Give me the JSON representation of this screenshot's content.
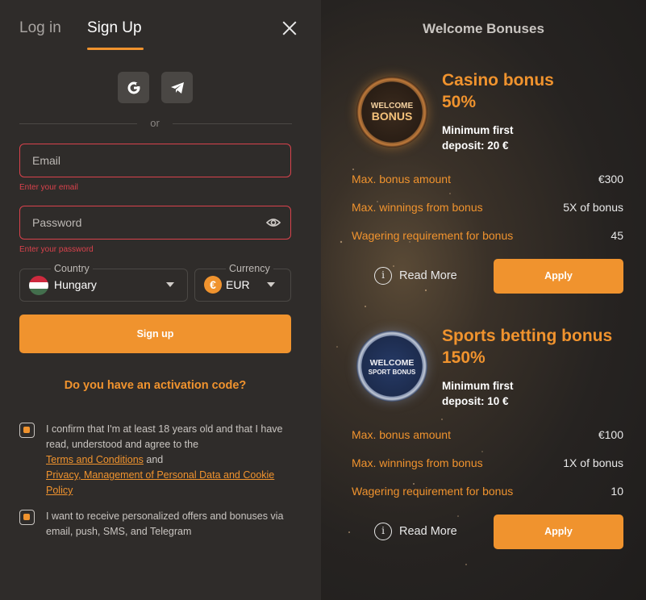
{
  "tabs": {
    "login": "Log in",
    "signup": "Sign Up"
  },
  "divider": "or",
  "email": {
    "placeholder": "Email",
    "error": "Enter your email"
  },
  "password": {
    "placeholder": "Password",
    "error": "Enter your password"
  },
  "country": {
    "legend": "Country",
    "value": "Hungary"
  },
  "currency": {
    "legend": "Currency",
    "value": "EUR",
    "symbol": "€"
  },
  "signup_button": "Sign up",
  "activation_link": "Do you have an activation code?",
  "consent": {
    "age_text": "I confirm that I'm at least 18 years old and that I have read, understood and agree to the",
    "terms_link": "Terms and Conditions",
    "and": "and",
    "privacy_link": "Privacy, Management of Personal Data and Cookie Policy",
    "offers_text": "I want to receive personalized offers and bonuses via email, push, SMS, and Telegram"
  },
  "bonuses": {
    "title": "Welcome Bonuses",
    "casino": {
      "coin_line1": "WELCOME",
      "coin_line2": "BONUS",
      "title_line1": "Casino bonus",
      "title_line2": "50%",
      "sub_line1": "Minimum first",
      "sub_line2": "deposit: 20 €",
      "rows": [
        {
          "k": "Max. bonus amount",
          "v": "€300"
        },
        {
          "k": "Max. winnings from bonus",
          "v": "5X of bonus"
        },
        {
          "k": "Wagering requirement for bonus",
          "v": "45"
        }
      ],
      "read_more": "Read More",
      "apply": "Apply"
    },
    "sport": {
      "coin_line1": "WELCOME",
      "coin_line2": "SPORT BONUS",
      "title_line1": "Sports betting bonus",
      "title_line2": "150%",
      "sub_line1": "Minimum first",
      "sub_line2": "deposit: 10 €",
      "rows": [
        {
          "k": "Max. bonus amount",
          "v": "€100"
        },
        {
          "k": "Max. winnings from bonus",
          "v": "1X of bonus"
        },
        {
          "k": "Wagering requirement for bonus",
          "v": "10"
        }
      ],
      "read_more": "Read More",
      "apply": "Apply"
    }
  },
  "colors": {
    "accent": "#f0932e",
    "error": "#d9424c",
    "panel": "#2f2c2a"
  }
}
